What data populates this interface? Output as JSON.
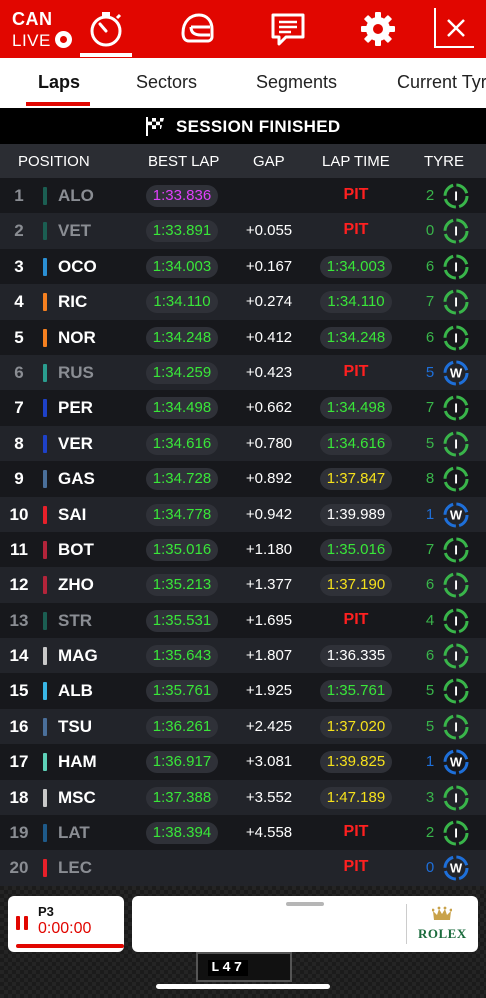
{
  "header": {
    "location": "CAN",
    "live_label": "LIVE"
  },
  "tabs": [
    {
      "label": "Laps",
      "active": true
    },
    {
      "label": "Sectors",
      "active": false
    },
    {
      "label": "Segments",
      "active": false
    },
    {
      "label": "Current Tyres",
      "active": false
    }
  ],
  "session": {
    "status": "SESSION FINISHED"
  },
  "columns": {
    "position": "POSITION",
    "best_lap": "BEST LAP",
    "gap": "GAP",
    "lap_time": "LAP TIME",
    "tyre": "TYRE"
  },
  "colors": {
    "brand_red": "#e10600",
    "fastest_purple": "#e040fb",
    "personal_best_green": "#39e639",
    "yellow": "#f5e11c",
    "tyre_intermediate": "#39b54a",
    "tyre_wet": "#1e6fd9"
  },
  "rows": [
    {
      "pos": "1",
      "code": "ALO",
      "team_color": "#1b5e52",
      "best": "1:33.836",
      "best_color": "#e040fb",
      "gap": "",
      "lap": "PIT",
      "lap_color": "",
      "laps": "2",
      "tyre": "I",
      "dim": true
    },
    {
      "pos": "2",
      "code": "VET",
      "team_color": "#1b5e52",
      "best": "1:33.891",
      "best_color": "#39e639",
      "gap": "+0.055",
      "lap": "PIT",
      "lap_color": "",
      "laps": "0",
      "tyre": "I",
      "dim": true
    },
    {
      "pos": "3",
      "code": "OCO",
      "team_color": "#2a8fd4",
      "best": "1:34.003",
      "best_color": "#39e639",
      "gap": "+0.167",
      "lap": "1:34.003",
      "lap_color": "#39e639",
      "laps": "6",
      "tyre": "I",
      "dim": false
    },
    {
      "pos": "4",
      "code": "RIC",
      "team_color": "#f58020",
      "best": "1:34.110",
      "best_color": "#39e639",
      "gap": "+0.274",
      "lap": "1:34.110",
      "lap_color": "#39e639",
      "laps": "7",
      "tyre": "I",
      "dim": false
    },
    {
      "pos": "5",
      "code": "NOR",
      "team_color": "#f58020",
      "best": "1:34.248",
      "best_color": "#39e639",
      "gap": "+0.412",
      "lap": "1:34.248",
      "lap_color": "#39e639",
      "laps": "6",
      "tyre": "I",
      "dim": false
    },
    {
      "pos": "6",
      "code": "RUS",
      "team_color": "#2a9d8f",
      "best": "1:34.259",
      "best_color": "#39e639",
      "gap": "+0.423",
      "lap": "PIT",
      "lap_color": "",
      "laps": "5",
      "tyre": "W",
      "dim": true
    },
    {
      "pos": "7",
      "code": "PER",
      "team_color": "#1e41c8",
      "best": "1:34.498",
      "best_color": "#39e639",
      "gap": "+0.662",
      "lap": "1:34.498",
      "lap_color": "#39e639",
      "laps": "7",
      "tyre": "I",
      "dim": false
    },
    {
      "pos": "8",
      "code": "VER",
      "team_color": "#1e41c8",
      "best": "1:34.616",
      "best_color": "#39e639",
      "gap": "+0.780",
      "lap": "1:34.616",
      "lap_color": "#39e639",
      "laps": "5",
      "tyre": "I",
      "dim": false
    },
    {
      "pos": "9",
      "code": "GAS",
      "team_color": "#4a6f9a",
      "best": "1:34.728",
      "best_color": "#39e639",
      "gap": "+0.892",
      "lap": "1:37.847",
      "lap_color": "#f5e11c",
      "laps": "8",
      "tyre": "I",
      "dim": false
    },
    {
      "pos": "10",
      "code": "SAI",
      "team_color": "#e8202a",
      "best": "1:34.778",
      "best_color": "#39e639",
      "gap": "+0.942",
      "lap": "1:39.989",
      "lap_color": "#ffffff",
      "laps": "1",
      "tyre": "W",
      "dim": false
    },
    {
      "pos": "11",
      "code": "BOT",
      "team_color": "#b3243a",
      "best": "1:35.016",
      "best_color": "#39e639",
      "gap": "+1.180",
      "lap": "1:35.016",
      "lap_color": "#39e639",
      "laps": "7",
      "tyre": "I",
      "dim": false
    },
    {
      "pos": "12",
      "code": "ZHO",
      "team_color": "#b3243a",
      "best": "1:35.213",
      "best_color": "#39e639",
      "gap": "+1.377",
      "lap": "1:37.190",
      "lap_color": "#f5e11c",
      "laps": "6",
      "tyre": "I",
      "dim": false
    },
    {
      "pos": "13",
      "code": "STR",
      "team_color": "#1b5e52",
      "best": "1:35.531",
      "best_color": "#39e639",
      "gap": "+1.695",
      "lap": "PIT",
      "lap_color": "",
      "laps": "4",
      "tyre": "I",
      "dim": true
    },
    {
      "pos": "14",
      "code": "MAG",
      "team_color": "#c9c9c9",
      "best": "1:35.643",
      "best_color": "#39e639",
      "gap": "+1.807",
      "lap": "1:36.335",
      "lap_color": "#ffffff",
      "laps": "6",
      "tyre": "I",
      "dim": false
    },
    {
      "pos": "15",
      "code": "ALB",
      "team_color": "#39b6e6",
      "best": "1:35.761",
      "best_color": "#39e639",
      "gap": "+1.925",
      "lap": "1:35.761",
      "lap_color": "#39e639",
      "laps": "5",
      "tyre": "I",
      "dim": false
    },
    {
      "pos": "16",
      "code": "TSU",
      "team_color": "#4a6f9a",
      "best": "1:36.261",
      "best_color": "#39e639",
      "gap": "+2.425",
      "lap": "1:37.020",
      "lap_color": "#f5e11c",
      "laps": "5",
      "tyre": "I",
      "dim": false
    },
    {
      "pos": "17",
      "code": "HAM",
      "team_color": "#5ed1b8",
      "best": "1:36.917",
      "best_color": "#39e639",
      "gap": "+3.081",
      "lap": "1:39.825",
      "lap_color": "#f5e11c",
      "laps": "1",
      "tyre": "W",
      "dim": false
    },
    {
      "pos": "18",
      "code": "MSC",
      "team_color": "#c9c9c9",
      "best": "1:37.388",
      "best_color": "#39e639",
      "gap": "+3.552",
      "lap": "1:47.189",
      "lap_color": "#f5e11c",
      "laps": "3",
      "tyre": "I",
      "dim": false
    },
    {
      "pos": "19",
      "code": "LAT",
      "team_color": "#1e5a8a",
      "best": "1:38.394",
      "best_color": "#39e639",
      "gap": "+4.558",
      "lap": "PIT",
      "lap_color": "",
      "laps": "2",
      "tyre": "I",
      "dim": true
    },
    {
      "pos": "20",
      "code": "LEC",
      "team_color": "#e8202a",
      "best": "",
      "best_color": "",
      "gap": "",
      "lap": "PIT",
      "lap_color": "",
      "laps": "0",
      "tyre": "W",
      "dim": true
    }
  ],
  "player": {
    "label": "P3",
    "time": "0:00:00"
  },
  "sponsor": {
    "name": "ROLEX"
  },
  "lap_board": "L47"
}
